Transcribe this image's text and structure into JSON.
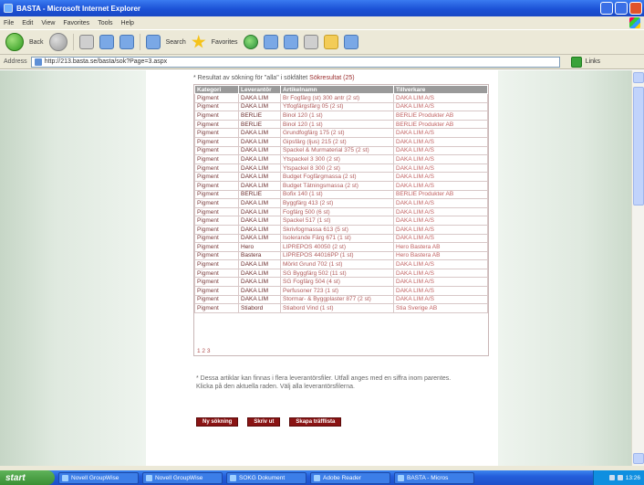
{
  "window": {
    "title": "BASTA - Microsoft Internet Explorer"
  },
  "menu": [
    "File",
    "Edit",
    "View",
    "Favorites",
    "Tools",
    "Help"
  ],
  "toolbar": {
    "back_label": "Back",
    "search_label": "Search",
    "favorites_label": "Favorites"
  },
  "address": {
    "label": "Address",
    "url": "http://213.basta.se/basta/sok?Page=3.aspx",
    "links_label": "Links"
  },
  "page": {
    "heading_prefix": "* Resultat av sökning för \"alla\" i sökfältet",
    "heading_link": "Sökresultat (25)",
    "columns": [
      "Kategori",
      "Leverantör",
      "Artikelnamn",
      "Tillverkare"
    ],
    "rows": [
      [
        "Pigment",
        "DAKA LIM",
        "Br Fogfärg (st) 300 antr (2 st)",
        "DAKA LIM A/S"
      ],
      [
        "Pigment",
        "DAKA LIM",
        "Ytfogfärgsfärg 05 (2 st)",
        "DAKA LIM A/S"
      ],
      [
        "Pigment",
        "BERLIE",
        "Binol 120 (1 st)",
        "BERLIE Produkter AB"
      ],
      [
        "Pigment",
        "BERLIE",
        "Binol 120 (1 st)",
        "BERLIE Produkter AB"
      ],
      [
        "Pigment",
        "DAKA LIM",
        "Grundfogfärg 175 (2 st)",
        "DAKA LIM A/S"
      ],
      [
        "Pigment",
        "DAKA LIM",
        "Gipsfärg (ljus) 215 (2 st)",
        "DAKA LIM A/S"
      ],
      [
        "Pigment",
        "DAKA LIM",
        "Spackel & Murmaterial 375 (2 st)",
        "DAKA LIM A/S"
      ],
      [
        "Pigment",
        "DAKA LIM",
        "Ytspackel 3 300 (2 st)",
        "DAKA LIM A/S"
      ],
      [
        "Pigment",
        "DAKA LIM",
        "Ytspackel 8 300 (2 st)",
        "DAKA LIM A/S"
      ],
      [
        "Pigment",
        "DAKA LIM",
        "Budget Fogfärgmassa (2 st)",
        "DAKA LIM A/S"
      ],
      [
        "Pigment",
        "DAKA LIM",
        "Budget Tätningsmassa (2 st)",
        "DAKA LIM A/S"
      ],
      [
        "Pigment",
        "BERLIE",
        "Bofix 140 (1 st)",
        "BERLIE Produkter AB"
      ],
      [
        "Pigment",
        "DAKA LIM",
        "Byggfärg 413 (2 st)",
        "DAKA LIM A/S"
      ],
      [
        "Pigment",
        "DAKA LIM",
        "Fogfärg 500 (6 st)",
        "DAKA LIM A/S"
      ],
      [
        "Pigment",
        "DAKA LIM",
        "Spackel 517 (1 st)",
        "DAKA LIM A/S"
      ],
      [
        "Pigment",
        "DAKA LIM",
        "Skrivfogmassa 613 (5 st)",
        "DAKA LIM A/S"
      ],
      [
        "Pigment",
        "DAKA LIM",
        "Isolerande Färg 671 (1 st)",
        "DAKA LIM A/S"
      ],
      [
        "Pigment",
        "Hero",
        "LIPREPOS 40050 (2 st)",
        "Hero Bastera AB"
      ],
      [
        "Pigment",
        "Bastera",
        "LIPREPOS 44016PP (1 st)",
        "Hero Bastera AB"
      ],
      [
        "Pigment",
        "DAKA LIM",
        "Mörkt Grund 702 (1 st)",
        "DAKA LIM A/S"
      ],
      [
        "Pigment",
        "DAKA LIM",
        "SG Byggfärg 502 (11 st)",
        "DAKA LIM A/S"
      ],
      [
        "Pigment",
        "DAKA LIM",
        "SG Fogfärg 504 (4 st)",
        "DAKA LIM A/S"
      ],
      [
        "Pigment",
        "DAKA LIM",
        "Perfusoner 723 (1 st)",
        "DAKA LIM A/S"
      ],
      [
        "Pigment",
        "DAKA LIM",
        "Stormar- & Byggplaster 877 (2 st)",
        "DAKA LIM A/S"
      ],
      [
        "Pigment",
        "Stiabord",
        "Stiabord Vind (1 st)",
        "Stia Sverige AB"
      ]
    ],
    "pager": "1 2 3",
    "note": "* Dessa artiklar kan finnas i flera leverantörsfiler. Utfall anges med en siffra inom parentes. Klicka på den aktuella raden. Välj alla leverantörsfilerna.",
    "buttons": [
      "Ny sökning",
      "Skriv ut",
      "Skapa träfflista"
    ]
  },
  "taskbar": {
    "start_label": "start",
    "items": [
      "Novell GroupWise",
      "Novell GroupWise",
      "SOKG Dokument",
      "Adobe Reader",
      "BASTA - Micros"
    ],
    "clock": "13:26"
  }
}
